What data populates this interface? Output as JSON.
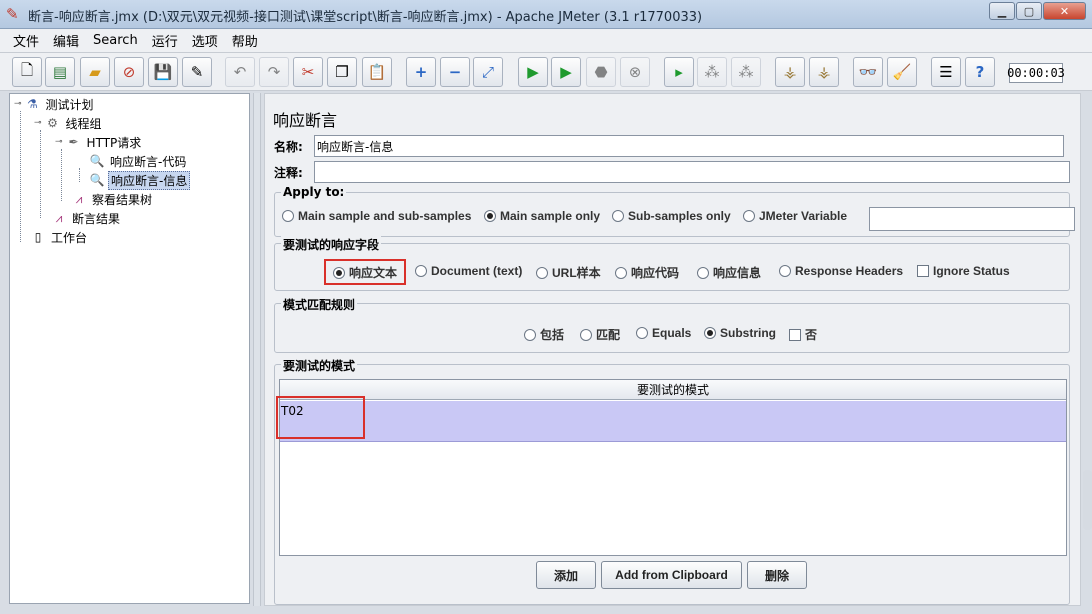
{
  "window": {
    "title": "断言-响应断言.jmx (D:\\双元\\双元视频-接口测试\\课堂script\\断言-响应断言.jmx) - Apache JMeter (3.1 r1770033)",
    "app_icon": "feather-icon"
  },
  "menu": [
    "文件",
    "编辑",
    "Search",
    "运行",
    "选项",
    "帮助"
  ],
  "toolbar": {
    "timer": "00:00:03"
  },
  "tree": {
    "test_plan": "测试计划",
    "thread_group": "线程组",
    "http_request": "HTTP请求",
    "assert_code": "响应断言-代码",
    "assert_info": "响应断言-信息",
    "view_results": "察看结果树",
    "assert_results": "断言结果",
    "workbench": "工作台"
  },
  "panel": {
    "title": "响应断言",
    "name_label": "名称:",
    "name_value": "响应断言-信息",
    "comment_label": "注释:",
    "comment_value": ""
  },
  "apply_to": {
    "label": "Apply to:",
    "options": [
      "Main sample and sub-samples",
      "Main sample only",
      "Sub-samples only",
      "JMeter Variable"
    ],
    "selected_index": 1,
    "variable_value": ""
  },
  "field": {
    "label": "要测试的响应字段",
    "options": [
      "响应文本",
      "Document (text)",
      "URL样本",
      "响应代码",
      "响应信息",
      "Response Headers"
    ],
    "selected_index": 0,
    "ignore_status": "Ignore Status"
  },
  "rules": {
    "label": "模式匹配规则",
    "options": [
      "包括",
      "匹配",
      "Equals",
      "Substring"
    ],
    "selected_index": 3,
    "not_label": "否"
  },
  "patterns": {
    "label": "要测试的模式",
    "column_header": "要测试的模式",
    "rows": [
      "T02"
    ]
  },
  "buttons": {
    "add": "添加",
    "clipboard": "Add from Clipboard",
    "delete": "删除"
  },
  "colors": {
    "selected_row": "#c9c8f5",
    "highlight_box": "#d9302a"
  }
}
